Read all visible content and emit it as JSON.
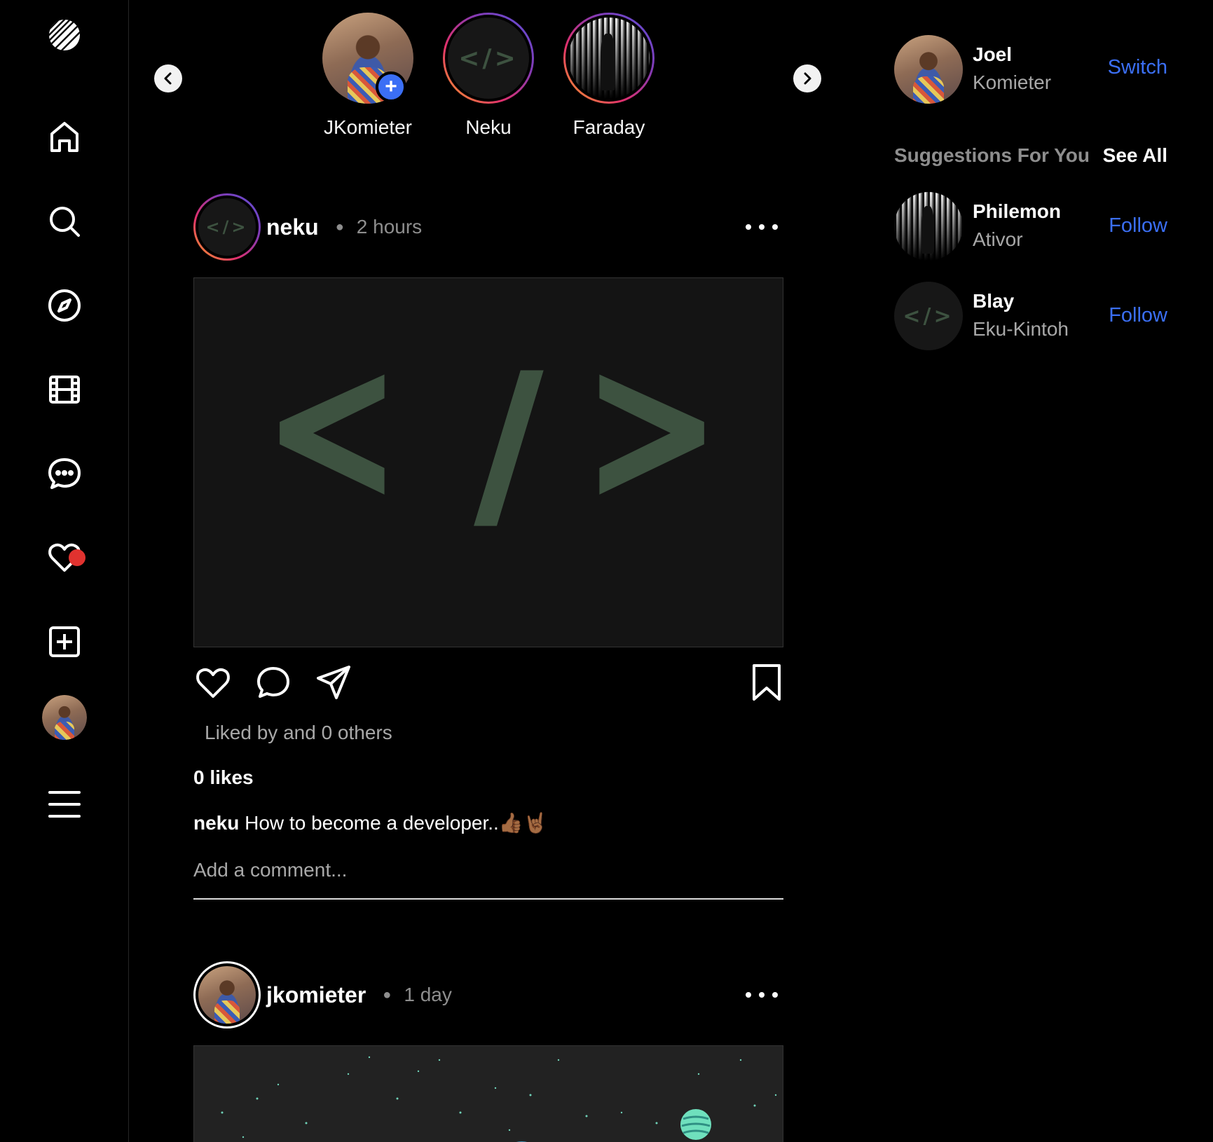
{
  "sidebar": {
    "items": [
      {
        "name": "home"
      },
      {
        "name": "search"
      },
      {
        "name": "explore"
      },
      {
        "name": "reels"
      },
      {
        "name": "messages"
      },
      {
        "name": "notifications"
      },
      {
        "name": "create"
      },
      {
        "name": "profile"
      },
      {
        "name": "more"
      }
    ]
  },
  "stories": [
    {
      "name": "JKomieter"
    },
    {
      "name": "Neku"
    },
    {
      "name": "Faraday"
    }
  ],
  "posts": [
    {
      "user": "neku",
      "time": "2 hours",
      "image_text": "< / >",
      "liked_by": "Liked by and 0 others",
      "likes": "0 likes",
      "caption_user": "neku",
      "caption_text": " How to become a developer..👍🏾🤘🏾",
      "comment_placeholder": "Add a comment..."
    },
    {
      "user": "jkomieter",
      "time": "1 day"
    }
  ],
  "right": {
    "me": {
      "first": "Joel",
      "last": "Komieter",
      "action": "Switch"
    },
    "suggestions_title": "Suggestions For You",
    "see_all": "See All",
    "suggestions": [
      {
        "first": "Philemon",
        "last": "Ativor",
        "action": "Follow"
      },
      {
        "first": "Blay",
        "last": "Eku-Kintoh",
        "action": "Follow"
      }
    ]
  },
  "colors": {
    "background": "#000000",
    "accent_blue": "#3b6ff5",
    "notification_dot": "#e0322f",
    "muted_text": "#a8a8a8",
    "code_green": "#3d5240"
  }
}
